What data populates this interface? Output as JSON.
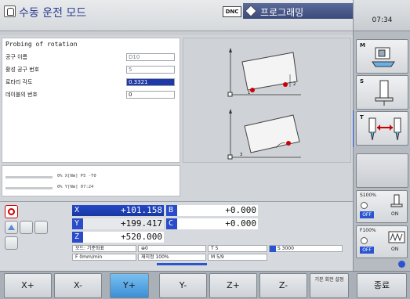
{
  "header": {
    "mode_title": "수동 운전 모드",
    "dnc": "DNC",
    "program_tab": "프로그래밍",
    "clock": "07:34"
  },
  "form": {
    "title": "Probing of rotation",
    "fields": [
      {
        "label": "공구 이름",
        "value": "D10"
      },
      {
        "label": "활성 공구 번호",
        "value": "5"
      },
      {
        "label": "로타리 각도",
        "value": "0.3321"
      },
      {
        "label": "데이블의 번호",
        "value": "0"
      }
    ]
  },
  "status": {
    "line1": "0% X[Nm] P5  -T0",
    "line2": "0% Y[Nm] 07:24"
  },
  "graphics": {
    "label_top": "2",
    "label_top_x": "1",
    "label_bottom": "3"
  },
  "positions": {
    "x": {
      "name": "X",
      "value": "+101.158"
    },
    "y": {
      "name": "Y",
      "value": "+199.417"
    },
    "z": {
      "name": "Z",
      "value": "+520.000"
    },
    "b": {
      "name": "B",
      "value": "+0.000"
    },
    "c": {
      "name": "C",
      "value": "+0.000"
    },
    "mode_basic": "모드: 기준좌표",
    "feed": "F 0mm/min",
    "datum": "0",
    "rapid": "재지정 100%",
    "tool": "T 5",
    "spindle_label": "S 3000",
    "mfunc": "M 5/9"
  },
  "override": {
    "spindle_pct": "S100%",
    "feed_pct": "F100%",
    "off": "OFF",
    "on": "ON"
  },
  "right_softkeys": [
    "M",
    "S",
    "T",
    ""
  ],
  "softkeys": [
    "X+",
    "X-",
    "Y+",
    "Y-",
    "Z+",
    "Z-",
    "기본 회전 설정",
    "종료"
  ],
  "colors": {
    "accent": "#2348c8",
    "selected_softkey": "#5aa8e6"
  }
}
